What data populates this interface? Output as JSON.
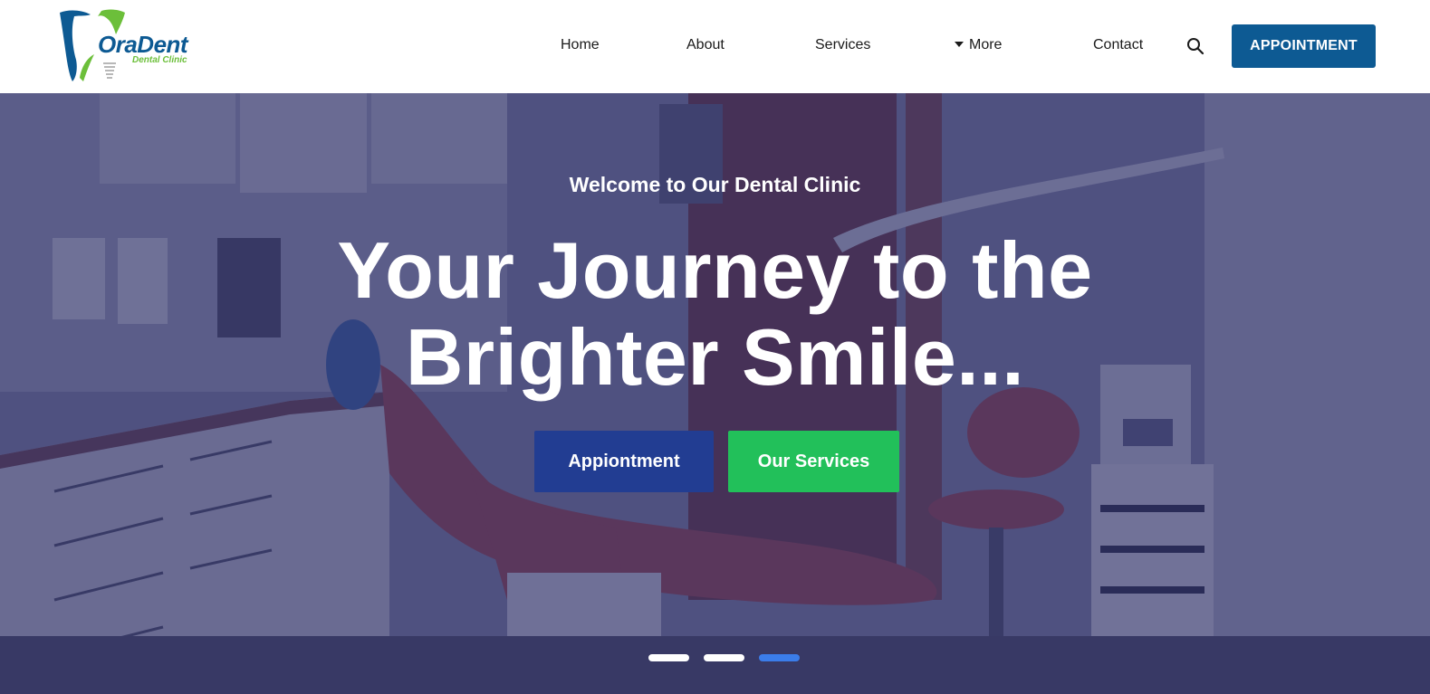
{
  "brand": {
    "name": "OraDent",
    "tagline": "Dental Clinic",
    "primary_color": "#0d5a93",
    "accent_color": "#6cbf3a"
  },
  "nav": {
    "items": [
      {
        "label": "Home"
      },
      {
        "label": "About"
      },
      {
        "label": "Services"
      },
      {
        "label": "More",
        "icon": "caret-down-icon"
      },
      {
        "label": "Contact"
      }
    ],
    "search_icon": "search-icon",
    "cta_label": "APPOINTMENT"
  },
  "hero": {
    "eyebrow": "Welcome to Our Dental Clinic",
    "title_line1": "Your Journey to the",
    "title_line2": "Brighter Smile...",
    "primary_button": "Appiontment",
    "secondary_button": "Our Services",
    "primary_button_color": "#223d92",
    "secondary_button_color": "#22c05a",
    "slides": [
      {
        "active": false
      },
      {
        "active": false
      },
      {
        "active": true
      }
    ],
    "active_dot_color": "#3b7dea"
  }
}
